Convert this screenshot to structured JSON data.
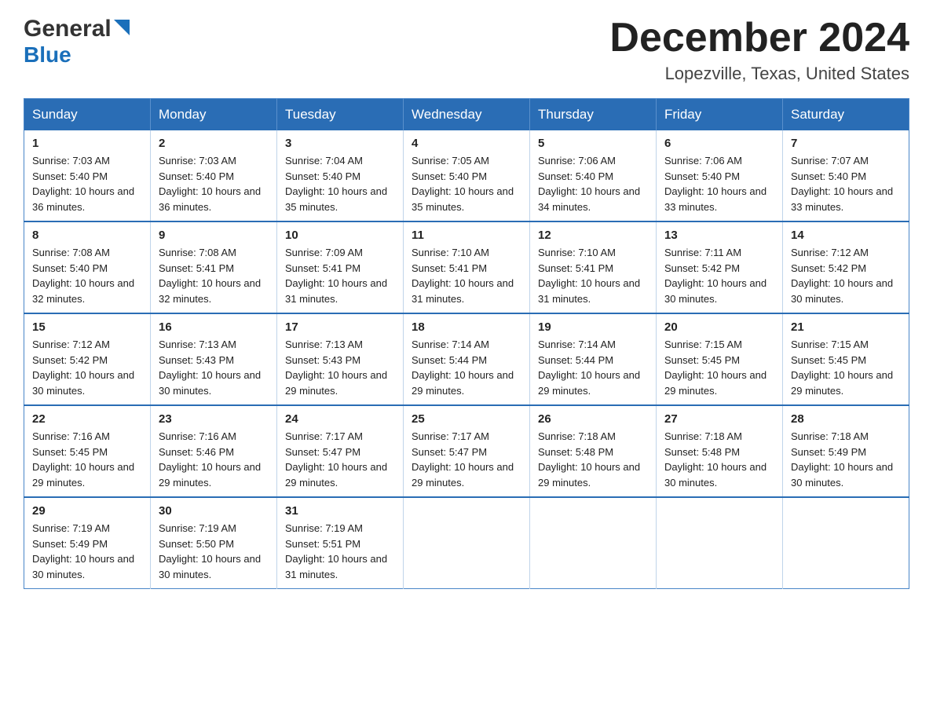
{
  "header": {
    "logo": {
      "part1": "General",
      "part2": "Blue"
    },
    "title": "December 2024",
    "location": "Lopezville, Texas, United States"
  },
  "weekdays": [
    "Sunday",
    "Monday",
    "Tuesday",
    "Wednesday",
    "Thursday",
    "Friday",
    "Saturday"
  ],
  "weeks": [
    [
      {
        "day": "1",
        "sunrise": "7:03 AM",
        "sunset": "5:40 PM",
        "daylight": "10 hours and 36 minutes."
      },
      {
        "day": "2",
        "sunrise": "7:03 AM",
        "sunset": "5:40 PM",
        "daylight": "10 hours and 36 minutes."
      },
      {
        "day": "3",
        "sunrise": "7:04 AM",
        "sunset": "5:40 PM",
        "daylight": "10 hours and 35 minutes."
      },
      {
        "day": "4",
        "sunrise": "7:05 AM",
        "sunset": "5:40 PM",
        "daylight": "10 hours and 35 minutes."
      },
      {
        "day": "5",
        "sunrise": "7:06 AM",
        "sunset": "5:40 PM",
        "daylight": "10 hours and 34 minutes."
      },
      {
        "day": "6",
        "sunrise": "7:06 AM",
        "sunset": "5:40 PM",
        "daylight": "10 hours and 33 minutes."
      },
      {
        "day": "7",
        "sunrise": "7:07 AM",
        "sunset": "5:40 PM",
        "daylight": "10 hours and 33 minutes."
      }
    ],
    [
      {
        "day": "8",
        "sunrise": "7:08 AM",
        "sunset": "5:40 PM",
        "daylight": "10 hours and 32 minutes."
      },
      {
        "day": "9",
        "sunrise": "7:08 AM",
        "sunset": "5:41 PM",
        "daylight": "10 hours and 32 minutes."
      },
      {
        "day": "10",
        "sunrise": "7:09 AM",
        "sunset": "5:41 PM",
        "daylight": "10 hours and 31 minutes."
      },
      {
        "day": "11",
        "sunrise": "7:10 AM",
        "sunset": "5:41 PM",
        "daylight": "10 hours and 31 minutes."
      },
      {
        "day": "12",
        "sunrise": "7:10 AM",
        "sunset": "5:41 PM",
        "daylight": "10 hours and 31 minutes."
      },
      {
        "day": "13",
        "sunrise": "7:11 AM",
        "sunset": "5:42 PM",
        "daylight": "10 hours and 30 minutes."
      },
      {
        "day": "14",
        "sunrise": "7:12 AM",
        "sunset": "5:42 PM",
        "daylight": "10 hours and 30 minutes."
      }
    ],
    [
      {
        "day": "15",
        "sunrise": "7:12 AM",
        "sunset": "5:42 PM",
        "daylight": "10 hours and 30 minutes."
      },
      {
        "day": "16",
        "sunrise": "7:13 AM",
        "sunset": "5:43 PM",
        "daylight": "10 hours and 30 minutes."
      },
      {
        "day": "17",
        "sunrise": "7:13 AM",
        "sunset": "5:43 PM",
        "daylight": "10 hours and 29 minutes."
      },
      {
        "day": "18",
        "sunrise": "7:14 AM",
        "sunset": "5:44 PM",
        "daylight": "10 hours and 29 minutes."
      },
      {
        "day": "19",
        "sunrise": "7:14 AM",
        "sunset": "5:44 PM",
        "daylight": "10 hours and 29 minutes."
      },
      {
        "day": "20",
        "sunrise": "7:15 AM",
        "sunset": "5:45 PM",
        "daylight": "10 hours and 29 minutes."
      },
      {
        "day": "21",
        "sunrise": "7:15 AM",
        "sunset": "5:45 PM",
        "daylight": "10 hours and 29 minutes."
      }
    ],
    [
      {
        "day": "22",
        "sunrise": "7:16 AM",
        "sunset": "5:45 PM",
        "daylight": "10 hours and 29 minutes."
      },
      {
        "day": "23",
        "sunrise": "7:16 AM",
        "sunset": "5:46 PM",
        "daylight": "10 hours and 29 minutes."
      },
      {
        "day": "24",
        "sunrise": "7:17 AM",
        "sunset": "5:47 PM",
        "daylight": "10 hours and 29 minutes."
      },
      {
        "day": "25",
        "sunrise": "7:17 AM",
        "sunset": "5:47 PM",
        "daylight": "10 hours and 29 minutes."
      },
      {
        "day": "26",
        "sunrise": "7:18 AM",
        "sunset": "5:48 PM",
        "daylight": "10 hours and 29 minutes."
      },
      {
        "day": "27",
        "sunrise": "7:18 AM",
        "sunset": "5:48 PM",
        "daylight": "10 hours and 30 minutes."
      },
      {
        "day": "28",
        "sunrise": "7:18 AM",
        "sunset": "5:49 PM",
        "daylight": "10 hours and 30 minutes."
      }
    ],
    [
      {
        "day": "29",
        "sunrise": "7:19 AM",
        "sunset": "5:49 PM",
        "daylight": "10 hours and 30 minutes."
      },
      {
        "day": "30",
        "sunrise": "7:19 AM",
        "sunset": "5:50 PM",
        "daylight": "10 hours and 30 minutes."
      },
      {
        "day": "31",
        "sunrise": "7:19 AM",
        "sunset": "5:51 PM",
        "daylight": "10 hours and 31 minutes."
      },
      null,
      null,
      null,
      null
    ]
  ],
  "labels": {
    "sunrise": "Sunrise:",
    "sunset": "Sunset:",
    "daylight": "Daylight:"
  }
}
